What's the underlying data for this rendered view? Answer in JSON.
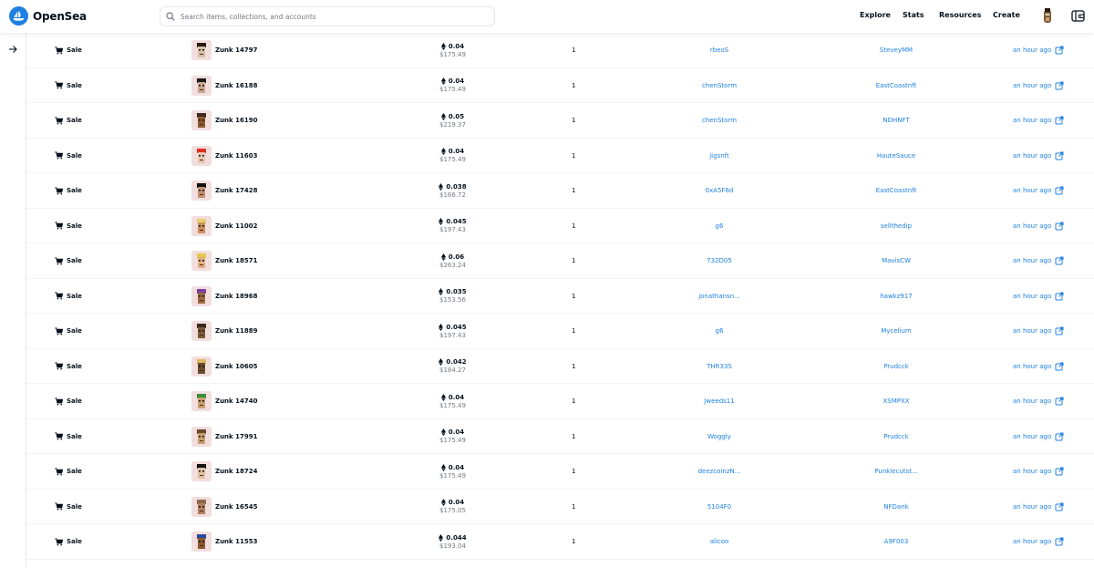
{
  "header": {
    "logo_text": "OpenSea",
    "search_placeholder": "Search items, collections, and accounts",
    "nav": [
      "Explore",
      "Stats",
      "Resources",
      "Create"
    ]
  },
  "colors": {
    "accent": "#2081e2",
    "text": "#04111d",
    "muted": "#707a83",
    "thumb_bg": "#f2dede"
  },
  "activity": {
    "rows": [
      {
        "event": "Sale",
        "item": "Zunk 14797",
        "price_eth": "0.04",
        "price_usd": "$175.49",
        "quantity": "1",
        "from": "rbeoS",
        "to": "SteveyMM",
        "time": "an hour ago"
      },
      {
        "event": "Sale",
        "item": "Zunk 16188",
        "price_eth": "0.04",
        "price_usd": "$175.49",
        "quantity": "1",
        "from": "chenStorm",
        "to": "EastCoastnft",
        "time": "an hour ago"
      },
      {
        "event": "Sale",
        "item": "Zunk 16190",
        "price_eth": "0.05",
        "price_usd": "$219.37",
        "quantity": "1",
        "from": "chenStorm",
        "to": "NDHNFT",
        "time": "an hour ago"
      },
      {
        "event": "Sale",
        "item": "Zunk 11603",
        "price_eth": "0.04",
        "price_usd": "$175.49",
        "quantity": "1",
        "from": "jigsnft",
        "to": "HauteSauce",
        "time": "an hour ago"
      },
      {
        "event": "Sale",
        "item": "Zunk 17428",
        "price_eth": "0.038",
        "price_usd": "$166.72",
        "quantity": "1",
        "from": "0xA5F6d",
        "to": "EastCoastnft",
        "time": "an hour ago"
      },
      {
        "event": "Sale",
        "item": "Zunk 11002",
        "price_eth": "0.045",
        "price_usd": "$197.43",
        "quantity": "1",
        "from": "g6",
        "to": "sellthedip",
        "time": "an hour ago"
      },
      {
        "event": "Sale",
        "item": "Zunk 18571",
        "price_eth": "0.06",
        "price_usd": "$263.24",
        "quantity": "1",
        "from": "732D05",
        "to": "MavisCW",
        "time": "an hour ago"
      },
      {
        "event": "Sale",
        "item": "Zunk 18968",
        "price_eth": "0.035",
        "price_usd": "$153.56",
        "quantity": "1",
        "from": "jonathansn...",
        "to": "hawkz917",
        "time": "an hour ago"
      },
      {
        "event": "Sale",
        "item": "Zunk 11889",
        "price_eth": "0.045",
        "price_usd": "$197.43",
        "quantity": "1",
        "from": "g6",
        "to": "Mycelium",
        "time": "an hour ago"
      },
      {
        "event": "Sale",
        "item": "Zunk 10605",
        "price_eth": "0.042",
        "price_usd": "$184.27",
        "quantity": "1",
        "from": "THR33S",
        "to": "Prudcck",
        "time": "an hour ago"
      },
      {
        "event": "Sale",
        "item": "Zunk 14740",
        "price_eth": "0.04",
        "price_usd": "$175.49",
        "quantity": "1",
        "from": "Jweeds11",
        "to": "XSMPXX",
        "time": "an hour ago"
      },
      {
        "event": "Sale",
        "item": "Zunk 17991",
        "price_eth": "0.04",
        "price_usd": "$175.49",
        "quantity": "1",
        "from": "Woggly",
        "to": "Prudcck",
        "time": "an hour ago"
      },
      {
        "event": "Sale",
        "item": "Zunk 18724",
        "price_eth": "0.04",
        "price_usd": "$175.49",
        "quantity": "1",
        "from": "deezcoinzN...",
        "to": "Punklecutst...",
        "time": "an hour ago"
      },
      {
        "event": "Sale",
        "item": "Zunk 16545",
        "price_eth": "0.04",
        "price_usd": "$175.05",
        "quantity": "1",
        "from": "5104F0",
        "to": "NFDank",
        "time": "an hour ago"
      },
      {
        "event": "Sale",
        "item": "Zunk 11553",
        "price_eth": "0.044",
        "price_usd": "$193.04",
        "quantity": "1",
        "from": "alicoo",
        "to": "A9F003",
        "time": "an hour ago"
      }
    ]
  }
}
